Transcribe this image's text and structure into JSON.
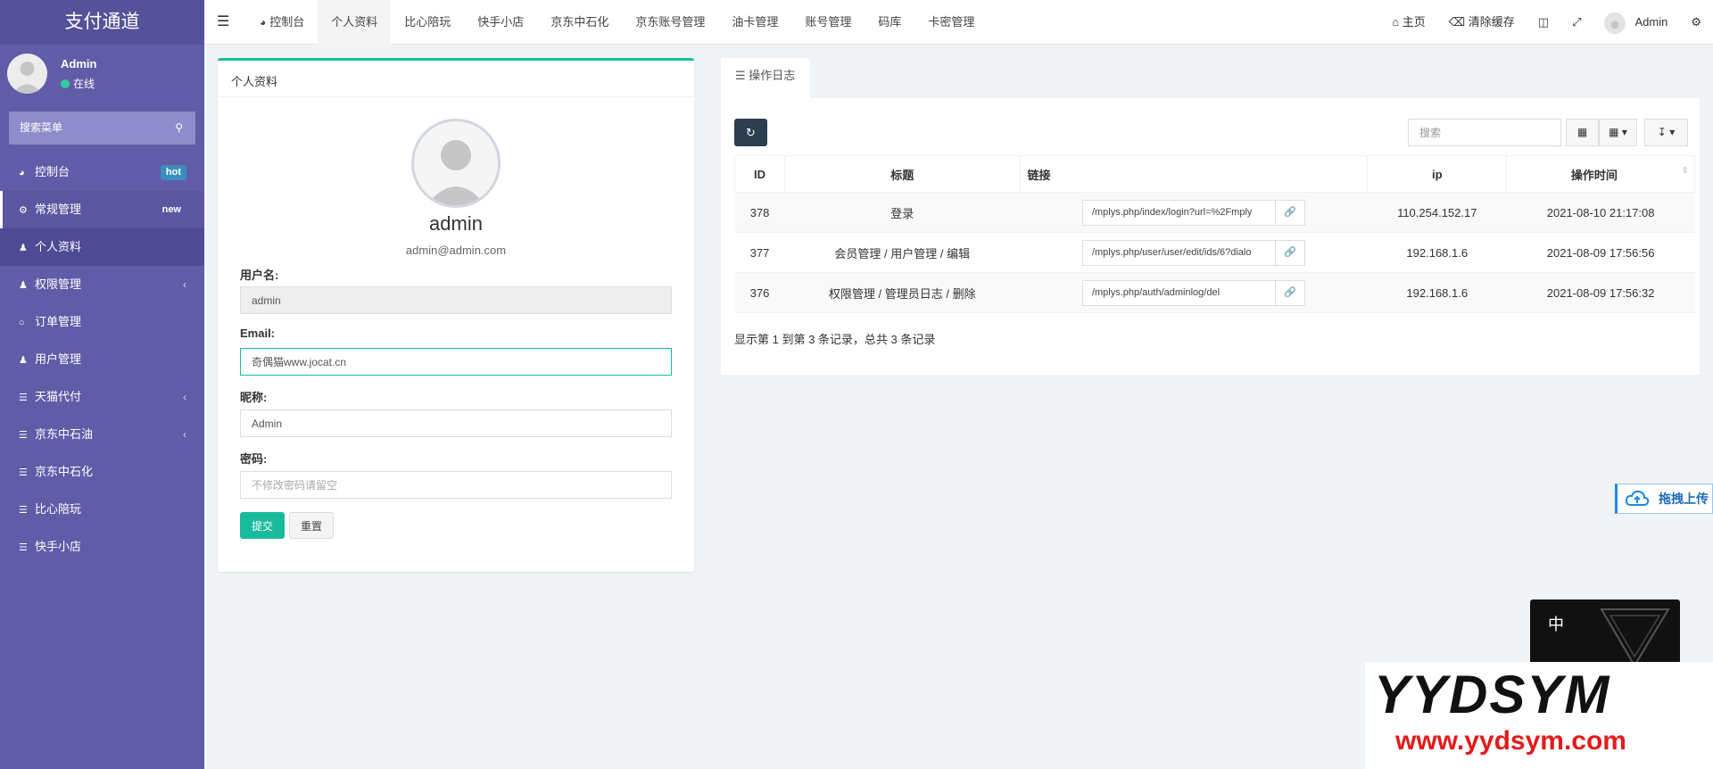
{
  "app": {
    "title": "支付通道"
  },
  "user": {
    "name": "Admin",
    "status": "在线"
  },
  "sidebar": {
    "search_placeholder": "搜索菜单",
    "items": [
      {
        "label": "控制台",
        "badge": "hot"
      },
      {
        "label": "常规管理",
        "badge": "new"
      },
      {
        "label": "个人资料"
      },
      {
        "label": "权限管理"
      },
      {
        "label": "订单管理"
      },
      {
        "label": "用户管理"
      },
      {
        "label": "天猫代付"
      },
      {
        "label": "京东中石油"
      },
      {
        "label": "京东中石化"
      },
      {
        "label": "比心陪玩"
      },
      {
        "label": "快手小店"
      }
    ]
  },
  "topbar": {
    "tabs": [
      "控制台",
      "个人资料",
      "比心陪玩",
      "快手小店",
      "京东中石化",
      "京东账号管理",
      "油卡管理",
      "账号管理",
      "码库",
      "卡密管理"
    ],
    "home": "主页",
    "clear_cache": "清除缓存",
    "user": "Admin"
  },
  "profile": {
    "card_title": "个人资料",
    "username": "admin",
    "email_display": "admin@admin.com",
    "username_label": "用户名:",
    "username_value": "admin",
    "email_label": "Email:",
    "email_value": "奇偶猫www.jocat.cn",
    "nickname_label": "昵称:",
    "nickname_value": "Admin",
    "password_label": "密码:",
    "password_placeholder": "不修改密码请留空",
    "submit": "提交",
    "reset": "重置"
  },
  "log": {
    "tab_label": "操作日志",
    "search_placeholder": "搜索",
    "columns": [
      "ID",
      "标题",
      "链接",
      "ip",
      "操作时间"
    ],
    "rows": [
      {
        "id": "378",
        "title": "登录",
        "link": "/mplys.php/index/login?url=%2Fmply",
        "ip": "110.254.152.17",
        "time": "2021-08-10 21:17:08"
      },
      {
        "id": "377",
        "title": "会员管理 / 用户管理 / 编辑",
        "link": "/mplys.php/user/user/edit/ids/6?dialo",
        "ip": "192.168.1.6",
        "time": "2021-08-09 17:56:56"
      },
      {
        "id": "376",
        "title": "权限管理 / 管理员日志 / 删除",
        "link": "/mplys.php/auth/adminlog/del",
        "ip": "192.168.1.6",
        "time": "2021-08-09 17:56:32"
      }
    ],
    "summary": "显示第 1 到第 3 条记录，总共 3 条记录"
  },
  "overlay": {
    "upload_label": "拖拽上传",
    "watermark_char": "中",
    "watermark_brand": "YYDSYM",
    "watermark_url": "www.yydsym.com"
  }
}
